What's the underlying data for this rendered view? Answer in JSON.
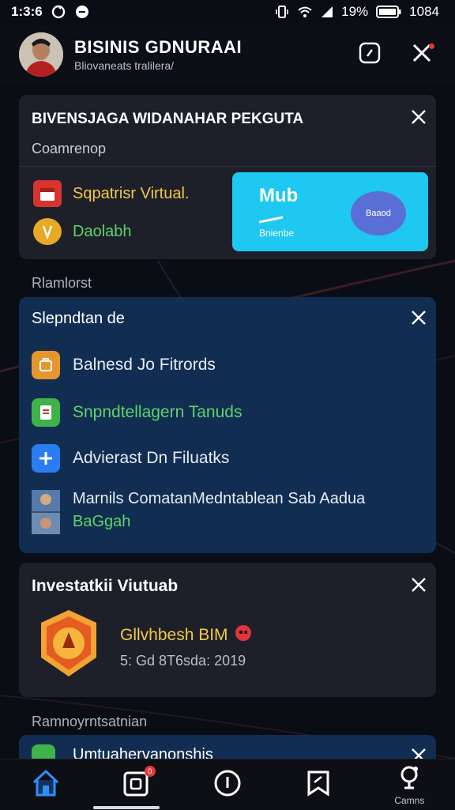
{
  "status_bar": {
    "time": "1:3:6",
    "battery": "19%",
    "right_value": "1084",
    "icons": [
      "sync-icon",
      "chat-bubble-icon",
      "vibrate-icon",
      "wifi-icon",
      "signal-icon",
      "battery-icon"
    ]
  },
  "header": {
    "title": "BISINIS GDNURAAI",
    "subtitle": "Bliovaneats tralilera/",
    "icons": [
      "square-action-icon",
      "close-icon"
    ]
  },
  "card1": {
    "title": "BIVENSJAGA WIDANAHAR PEKGUTA",
    "subtitle": "Coamrenop",
    "items": [
      {
        "label": "Sqpatrisr Virtual.",
        "color": "#f4c84a",
        "icon": "red-calendar-icon"
      },
      {
        "label": "Daolabh",
        "color": "#5fd36a",
        "icon": "gold-coin-icon"
      }
    ],
    "promo": {
      "title": "Mub",
      "sub": "Bnienbe",
      "badge": "Baaod"
    }
  },
  "section1": {
    "label": "Rlamlorst"
  },
  "card2": {
    "title": "Slepndtan de",
    "items": [
      {
        "label": "Balnesd Jo Fitrords",
        "color": "#e8ecf3",
        "icon": "briefcase-icon"
      },
      {
        "label": "Snpndtellagern Tanuds",
        "color": "#5fd36a",
        "icon": "green-document-icon"
      },
      {
        "label": "Advierast Dn Filuatks",
        "color": "#e8ecf3",
        "icon": "plus-icon"
      },
      {
        "label": "Marnils ComatanMedntablean Sab Aadua",
        "sub": "BaGgah",
        "color": "#e8ecf3",
        "icon": "people-photo-icon"
      }
    ]
  },
  "card3": {
    "title": "Investatkii Viutuab",
    "item": {
      "title": "Gllvhbesh BIM",
      "sub": "5: Gd 8T6sda: 2019",
      "icon": "badge-emblem-icon"
    }
  },
  "section2": {
    "label": "Ramnoyrntsatnian"
  },
  "card4": {
    "title": "Umtuahervanonshis"
  },
  "nav": {
    "items": [
      {
        "name": "home",
        "label": ""
      },
      {
        "name": "notifications",
        "label": "",
        "badge": "0"
      },
      {
        "name": "info",
        "label": ""
      },
      {
        "name": "bookmark",
        "label": ""
      },
      {
        "name": "camera",
        "label": "Camns"
      }
    ]
  },
  "colors": {
    "accent_blue": "#1e90ff",
    "promo_cyan": "#1ec8f0",
    "card_blue": "#112e52",
    "card_dark": "#1d2029"
  }
}
